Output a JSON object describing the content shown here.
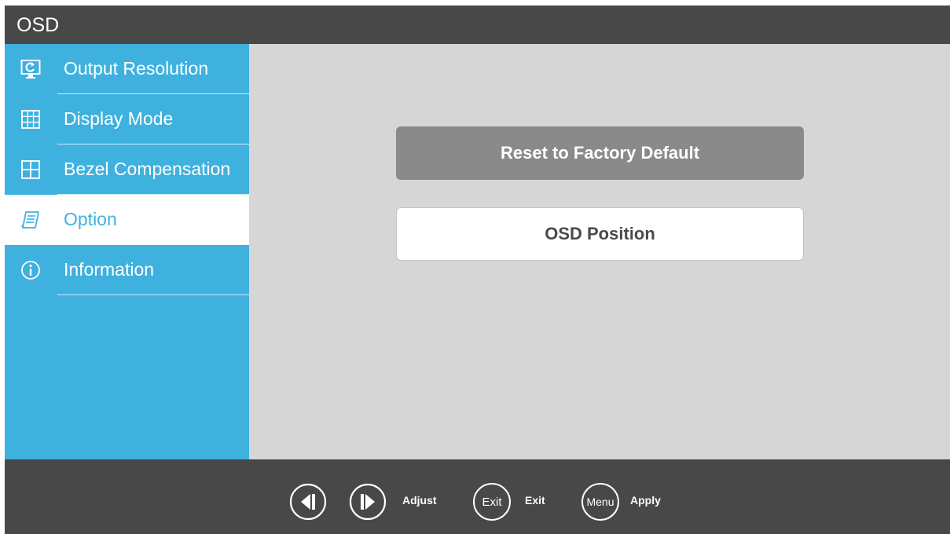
{
  "window": {
    "title": "OSD"
  },
  "sidebar": {
    "items": [
      {
        "label": "Output Resolution",
        "icon": "output-resolution-icon",
        "active": false
      },
      {
        "label": "Display Mode",
        "icon": "grid-icon",
        "active": false
      },
      {
        "label": "Bezel Compensation",
        "icon": "bezel-icon",
        "active": false
      },
      {
        "label": "Option",
        "icon": "option-document-icon",
        "active": true
      },
      {
        "label": "Information",
        "icon": "info-icon",
        "active": false
      }
    ]
  },
  "main": {
    "reset_label": "Reset to Factory Default",
    "osd_position_label": "OSD Position"
  },
  "footer": {
    "adjust_label": "Adjust",
    "exit_button_text": "Exit",
    "exit_label": "Exit",
    "menu_button_text": "Menu",
    "apply_label": "Apply"
  },
  "colors": {
    "accent": "#3fb1df",
    "bar": "#484848",
    "content_bg": "#d6d6d6",
    "selected_button": "#8a8a8a"
  }
}
